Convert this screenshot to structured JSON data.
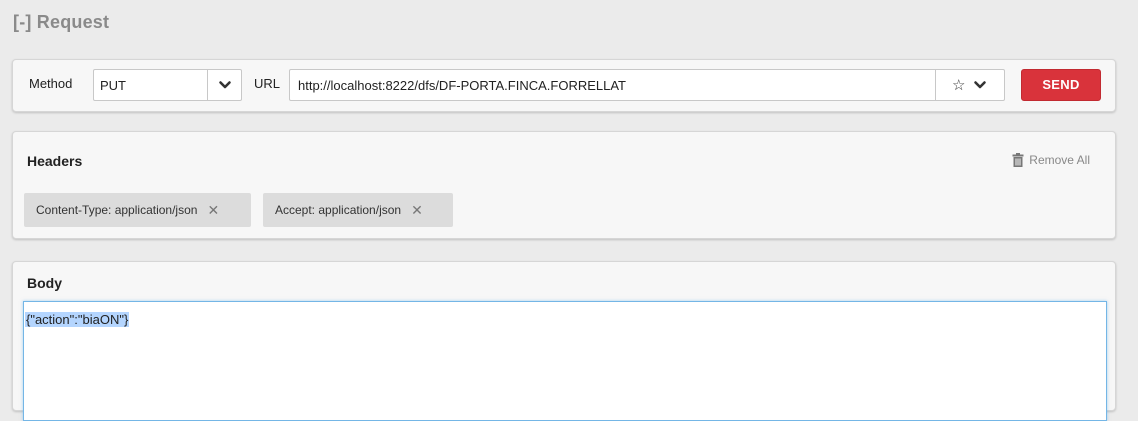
{
  "section": {
    "title": "[-] Request"
  },
  "request": {
    "method_label": "Method",
    "method_value": "PUT",
    "url_label": "URL",
    "url_value": "http://localhost:8222/dfs/DF-PORTA.FINCA.FORRELLAT",
    "star_glyph": "☆",
    "send_label": "SEND"
  },
  "headers": {
    "title": "Headers",
    "remove_all_label": "Remove All",
    "items": [
      {
        "label": "Content-Type: application/json",
        "remove_glyph": "✕"
      },
      {
        "label": "Accept: application/json",
        "remove_glyph": "✕"
      }
    ]
  },
  "body": {
    "title": "Body",
    "content": "{\"action\":\"biaON\"}"
  },
  "colors": {
    "send_button": "#d9333b",
    "focus_border": "#74b6e6",
    "selection": "#b4d5fe"
  },
  "icons": {
    "method_dropdown": "chevron-down-icon",
    "url_dropdown": "chevron-down-icon",
    "favorite": "star-icon",
    "remove_all": "trash-icon",
    "remove_header": "close-icon"
  }
}
